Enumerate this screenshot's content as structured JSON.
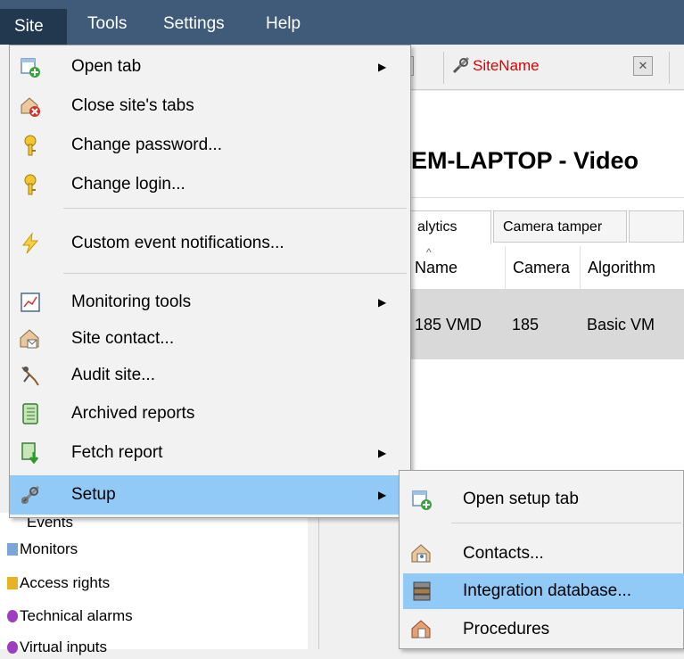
{
  "menubar": {
    "items": [
      "Site",
      "Tools",
      "Settings",
      "Help"
    ]
  },
  "background": {
    "site_tab_label": "SiteName",
    "page_title": "EM-LAPTOP - Video",
    "subtabs": [
      "alytics",
      "Camera tamper"
    ],
    "table": {
      "columns": [
        "Name",
        "Camera",
        "Algorithm"
      ],
      "rows": [
        [
          "185 VMD",
          "185",
          "Basic VM"
        ]
      ]
    },
    "tree_items": [
      "Events",
      "Monitors",
      "Access rights",
      "Technical alarms",
      "Virtual inputs"
    ]
  },
  "site_menu": {
    "items": [
      {
        "label": "Open tab",
        "icon": "open-tab-icon",
        "submenu": true
      },
      {
        "label": "Close site's tabs",
        "icon": "close-tabs-icon",
        "submenu": false
      },
      {
        "label": "Change password...",
        "icon": "key-icon",
        "submenu": false
      },
      {
        "label": "Change login...",
        "icon": "key-icon",
        "submenu": false
      },
      {
        "label": "Custom event notifications...",
        "icon": "lightning-icon",
        "submenu": false
      },
      {
        "label": "Monitoring tools",
        "icon": "chart-icon",
        "submenu": true
      },
      {
        "label": "Site contact...",
        "icon": "contact-icon",
        "submenu": false
      },
      {
        "label": "Audit site...",
        "icon": "audit-icon",
        "submenu": false
      },
      {
        "label": "Archived reports",
        "icon": "notebook-icon",
        "submenu": false
      },
      {
        "label": "Fetch report",
        "icon": "fetch-report-icon",
        "submenu": true
      },
      {
        "label": "Setup",
        "icon": "tools-icon",
        "submenu": true
      }
    ],
    "highlighted": "Setup"
  },
  "setup_submenu": {
    "items": [
      {
        "label": "Open setup tab",
        "icon": "open-tab-icon"
      },
      {
        "label": "Contacts...",
        "icon": "contact-icon"
      },
      {
        "label": "Integration database...",
        "icon": "database-icon"
      },
      {
        "label": "Procedures",
        "icon": "procedures-icon"
      }
    ],
    "highlighted": "Integration database..."
  },
  "colors": {
    "menubar_bg": "#3f5b79",
    "menubar_active_bg": "#22384f",
    "highlight": "#91c9f7",
    "site_tab_text": "#e00000"
  }
}
